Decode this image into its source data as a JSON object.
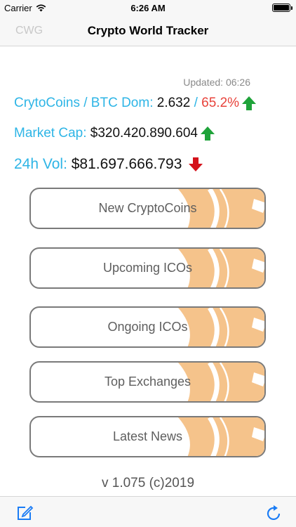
{
  "status_bar": {
    "carrier": "Carrier",
    "time": "6:26 AM"
  },
  "nav": {
    "left_label": "CWG",
    "title": "Crypto World Tracker"
  },
  "updated": "Updated: 06:26",
  "stats": {
    "coins_label": "CrytoCoins / BTC Dom:",
    "coins_value": "2.632",
    "separator": "/",
    "btc_dom_value": "65.2%",
    "market_cap_label": "Market Cap:",
    "market_cap_value": "$320.420.890.604",
    "vol_label": "24h Vol:",
    "vol_value": "$81.697.666.793"
  },
  "menu": [
    {
      "label": "New CryptoCoins"
    },
    {
      "label": "Upcoming ICOs"
    },
    {
      "label": "Ongoing ICOs"
    },
    {
      "label": "Top Exchanges"
    },
    {
      "label": "Latest News"
    }
  ],
  "version": "v 1.075 (c)2019",
  "icons": {
    "wifi": "wifi-icon",
    "battery": "battery-icon",
    "up_arrow": "arrow-up-icon",
    "down_arrow": "arrow-down-icon",
    "compose": "compose-icon",
    "refresh": "refresh-icon"
  },
  "colors": {
    "accent": "#2eb5e6",
    "negative": "#e8433b",
    "up_arrow": "#1fa33a",
    "down_arrow": "#d4111b",
    "coin": "#f5c38b",
    "tint": "#1a7cf5"
  }
}
